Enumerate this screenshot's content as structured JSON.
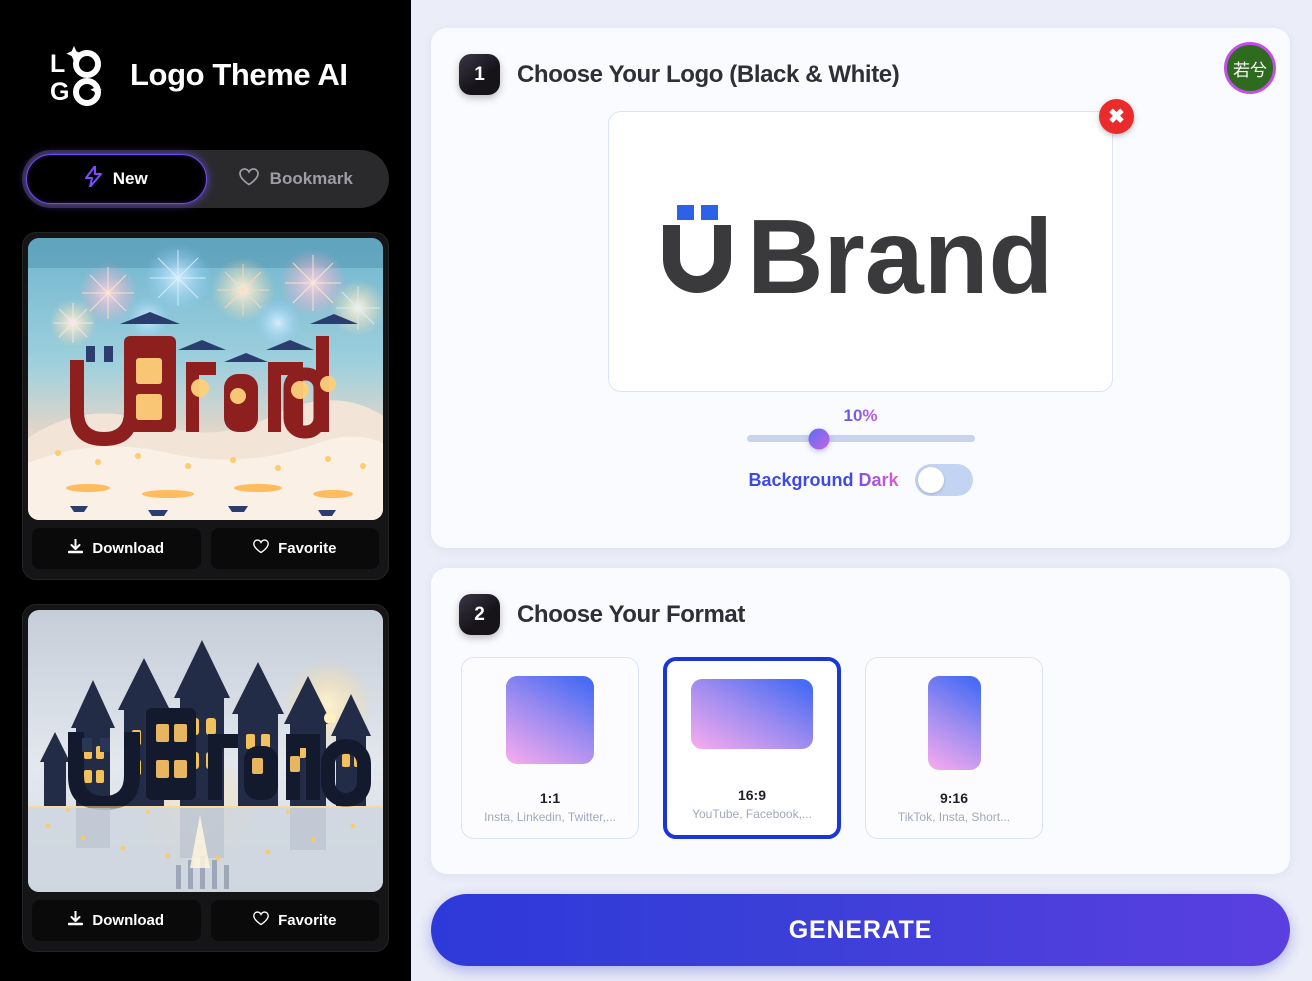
{
  "sidebar": {
    "brand_title": "Logo Theme AI",
    "logo_icon": "logo-wordmark-icon",
    "tabs": [
      {
        "label": "New",
        "icon": "lightning-bolt-icon",
        "active": true
      },
      {
        "label": "Bookmark",
        "icon": "heart-icon",
        "active": false
      }
    ],
    "cards": [
      {
        "alt": "Chinese New Year fireworks uBrand logo",
        "download_label": "Download",
        "favorite_label": "Favorite"
      },
      {
        "alt": "Illuminated castle uBrand logo",
        "download_label": "Download",
        "favorite_label": "Favorite"
      }
    ]
  },
  "user": {
    "avatar_initials": "若兮",
    "avatar_bg": "#2e6b1f",
    "avatar_ring": "#c44fe8"
  },
  "step1": {
    "number": "1",
    "title": "Choose Your Logo (Black & White)",
    "close_icon": "close-icon",
    "logo_text": "Brand",
    "slider": {
      "value_label": "10%",
      "value": 10,
      "position_pct": 32
    },
    "background_toggle": {
      "word1": "Background",
      "word2": "Dark",
      "on": false
    }
  },
  "step2": {
    "number": "2",
    "title": "Choose Your Format",
    "formats": [
      {
        "label": "1:1",
        "sub": "Insta, Linkedin, Twitter,...",
        "selected": false
      },
      {
        "label": "16:9",
        "sub": "YouTube, Facebook,...",
        "selected": true
      },
      {
        "label": "9:16",
        "sub": "TikTok, Insta, Short...",
        "selected": false
      }
    ]
  },
  "generate": {
    "label": "GENERATE",
    "color": "#2e39d9"
  }
}
